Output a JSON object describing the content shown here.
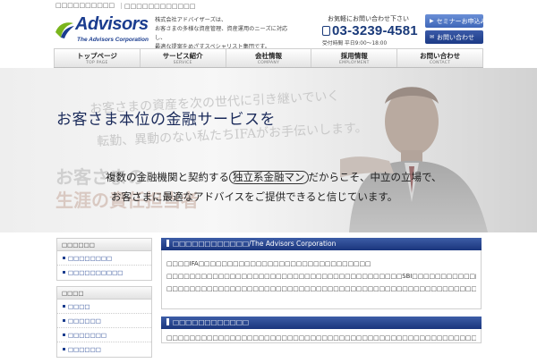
{
  "topbar": {
    "crumb1": "□□□□□□□□□□",
    "crumb2": "｜□□□□□□□□□□□□"
  },
  "logo": {
    "brand": "Advisors",
    "sub": "The Advisors Corporation"
  },
  "company_desc": [
    "株式会社アドバイザーズは、",
    "お客さまの多様な資産管理、資産運用のニーズに対応し、",
    "最適な提案をめざすスペシャリスト集団です。"
  ],
  "contact": {
    "lead": "お気軽にお問い合わせ下さい",
    "phone": "03-3239-4581",
    "hours": "受付時間 平日9:00～18:00"
  },
  "buttons": {
    "seminar": "セミナーお申込み",
    "contact": "お問い合わせ"
  },
  "nav": [
    {
      "jp": "トップページ",
      "en": "TOP PAGE"
    },
    {
      "jp": "サービス紹介",
      "en": "SERVICE"
    },
    {
      "jp": "会社情報",
      "en": "COMPANY"
    },
    {
      "jp": "採用情報",
      "en": "EMPLOYMENT"
    },
    {
      "jp": "お問い合わせ",
      "en": "CONTACT"
    }
  ],
  "hero": {
    "bg1": "お客さまの資産を次の世代に引き継いでいく",
    "bg2": "転勤、異動のない私たちIFAがお手伝いします。",
    "bg3": "お客さまの",
    "bg4": "生涯の責任担当者",
    "headline": "お客さま本位の金融サービスを",
    "line1_pre": "複数の金融機関と契約する",
    "line1_circ": "独立系金融マン",
    "line1_post": "だからこそ、中立の立場で、",
    "line2": "お客さまに最適なアドバイスをご提供できると信じています。"
  },
  "sidebar": [
    {
      "title": "□□□□□□",
      "links": [
        "□□□□□□□□",
        "□□□□□□□□□□"
      ]
    },
    {
      "title": "□□□□",
      "links": [
        "□□□□",
        "□□□□□□",
        "□□□□□□□",
        "□□□□□□"
      ]
    }
  ],
  "main": {
    "sec1_title": "□□□□□□□□□□□□/The Advisors Corporation",
    "sec1_lines": [
      "□□□□IFA□□□□□□□□□□□□□□□□□□□□□□□□□□□□□□",
      "□□□□□□□□□□□□□□□□□□□□□□□□□□□□□□□□□□□□□□□□□SBI□□□□□□□□□□□□□□□□□□□□□□□□",
      "□□□□□□□□□□□□□□□□□□□□□□□□□□□□□□□□□□□□□□□□□□□□□□□□□□□□□□□□□□□"
    ],
    "sec2_title": "□□□□□□□□□□□□",
    "sec2_lines": [
      "□□□□□□□□□□□□□□□□□□□□□□□□□□□□□□□□□□□□□□□□□□□□□□□□□□□□□□□□□□□□□□□□"
    ]
  },
  "colors": {
    "brand": "#1b3d8f",
    "section_bar": "#2a468f",
    "logo_green": "#7ab51d"
  }
}
